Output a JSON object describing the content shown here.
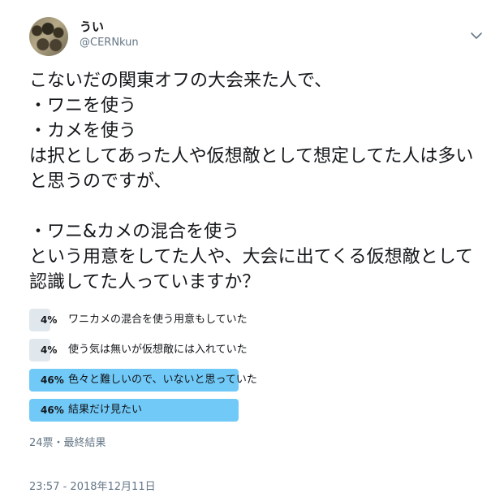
{
  "author": {
    "display_name": "うい",
    "handle": "@CERNkun",
    "avatar_icon": "avatar-photo-icon"
  },
  "menu_icon": "chevron-down-icon",
  "tweet_text": "こないだの関東オフの大会来た人で、\n・ワニを使う\n・カメを使う\nは択としてあった人や仮想敵として想定してた人は多いと思うのですが、\n\n・ワニ&カメの混合を使う\nという用意をしてた人や、大会に出てくる仮想敵として認識してた人っていますか？",
  "poll": {
    "choices": [
      {
        "percent": "4%",
        "value": 4,
        "label": "ワニカメの混合を使う用意もしていた",
        "winner": false
      },
      {
        "percent": "4%",
        "value": 4,
        "label": "使う気は無いが仮想敵には入れていた",
        "winner": false
      },
      {
        "percent": "46%",
        "value": 46,
        "label": "色々と難しいので、いないと思っていた",
        "winner": true
      },
      {
        "percent": "46%",
        "value": 46,
        "label": "結果だけ見たい",
        "winner": true
      }
    ],
    "meta": "24票・最終結果"
  },
  "timestamp": "23:57 - 2018年12月11日",
  "colors": {
    "winner_bar": "#71c9f8",
    "loser_bar": "#e1e8ed",
    "secondary_text": "#657786"
  }
}
